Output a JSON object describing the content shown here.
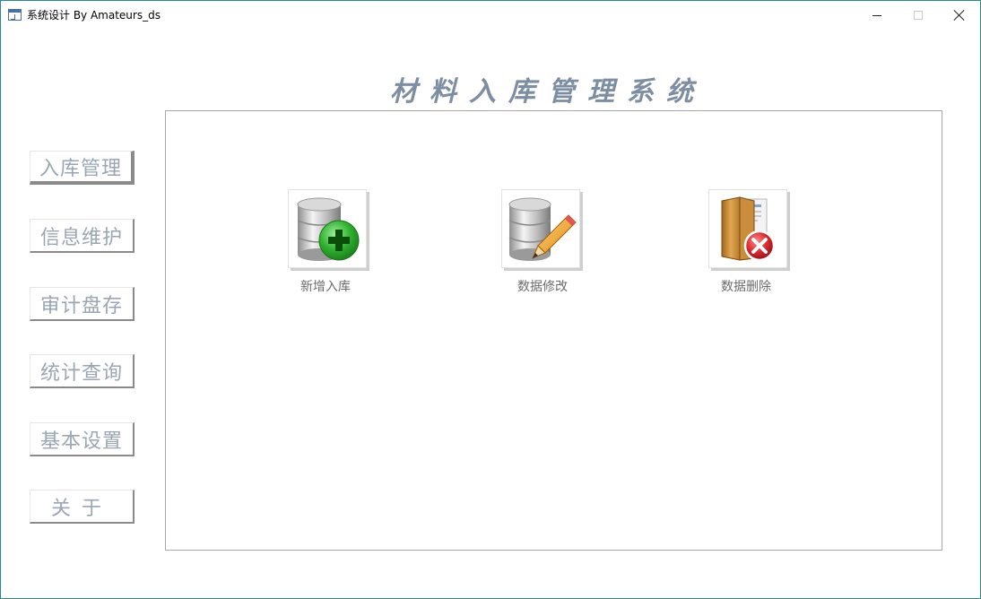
{
  "window": {
    "title": "系统设计 By Amateurs_ds"
  },
  "header": {
    "system_title": "材料入库管理系统"
  },
  "nav": {
    "items": [
      {
        "label": "入库管理"
      },
      {
        "label": "信息维护"
      },
      {
        "label": "审计盘存"
      },
      {
        "label": "统计查询"
      },
      {
        "label": "基本设置"
      },
      {
        "label": "关于"
      }
    ]
  },
  "actions": {
    "add": {
      "label": "新增入库",
      "icon": "database-add-icon"
    },
    "edit": {
      "label": "数据修改",
      "icon": "database-edit-icon"
    },
    "delete": {
      "label": "数据删除",
      "icon": "folder-delete-icon"
    }
  },
  "colors": {
    "accent": "#7d8ea3",
    "nav_text": "#9aa6b4",
    "add_green": "#2fb12f",
    "delete_red": "#d9262c"
  }
}
